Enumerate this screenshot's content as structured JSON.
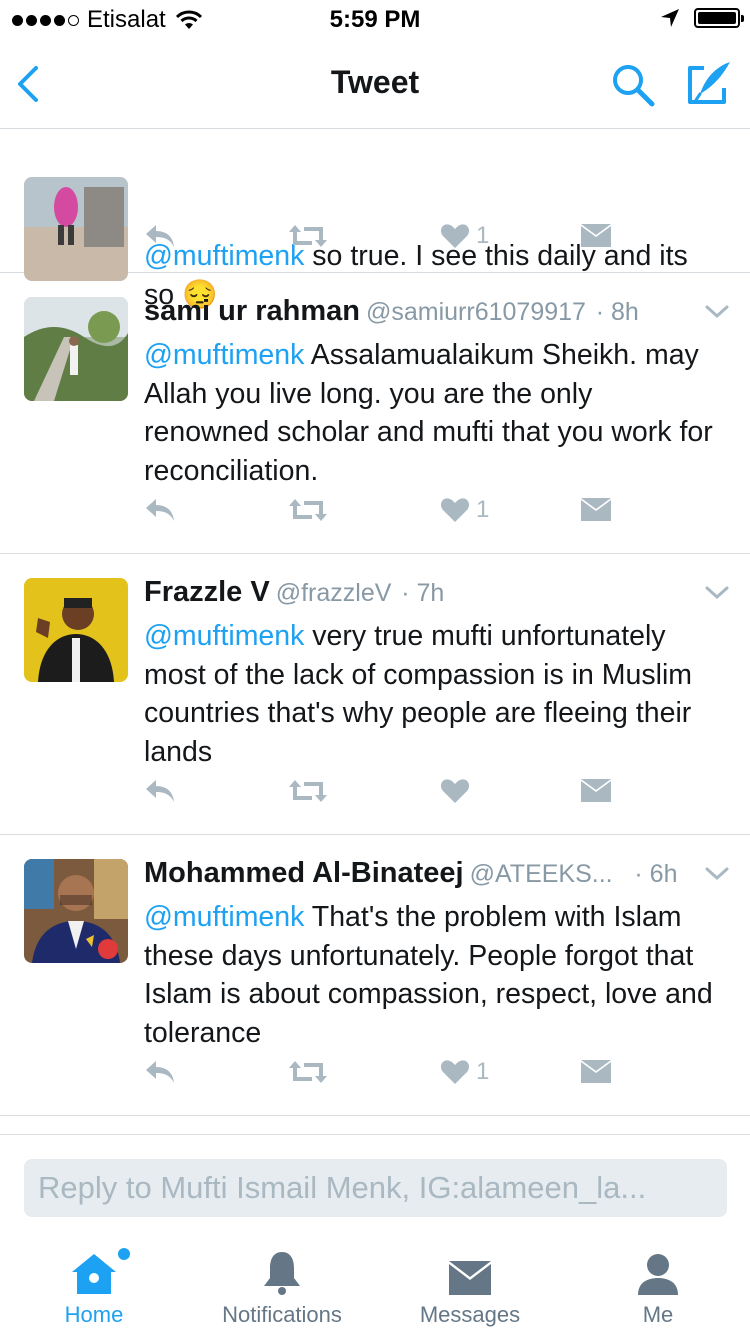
{
  "status": {
    "carrier": "Etisalat",
    "time": "5:59 PM"
  },
  "nav": {
    "title": "Tweet"
  },
  "tweets": [
    {
      "name": "",
      "handle": "",
      "time": "",
      "mention": "@muftimenk",
      "text": " so true. I see this daily and its so 😔",
      "likes": "1"
    },
    {
      "name": "sami ur rahman",
      "handle": "@samiurr61079917",
      "time": "· 8h",
      "mention": "@muftimenk",
      "text": " Assalamualaikum Sheikh. may Allah you live long. you are the only renowned scholar and mufti that you work for reconciliation.",
      "likes": "1"
    },
    {
      "name": "Frazzle V",
      "handle": "@frazzleV",
      "time": "· 7h",
      "mention": "@muftimenk",
      "text": " very true mufti unfortunately most of the lack of compassion is in Muslim countries that's why people are fleeing their lands",
      "likes": ""
    },
    {
      "name": "Mohammed Al-Binateej",
      "handle": "@ATEEKS...",
      "time": "· 6h",
      "mention": "@muftimenk",
      "text": " That's the problem with Islam these days unfortunately. People forgot that Islam is about compassion, respect, love and tolerance",
      "likes": "1"
    }
  ],
  "reply": {
    "placeholder": "Reply to Mufti Ismail Menk, IG:alameen_la..."
  },
  "tabs": [
    {
      "label": "Home",
      "icon": "home-icon"
    },
    {
      "label": "Notifications",
      "icon": "bell-icon"
    },
    {
      "label": "Messages",
      "icon": "envelope-icon"
    },
    {
      "label": "Me",
      "icon": "person-icon"
    }
  ],
  "colors": {
    "accent": "#1da1f2",
    "text": "#14171a",
    "muted": "#8899a6",
    "icon": "#aab8c2"
  }
}
